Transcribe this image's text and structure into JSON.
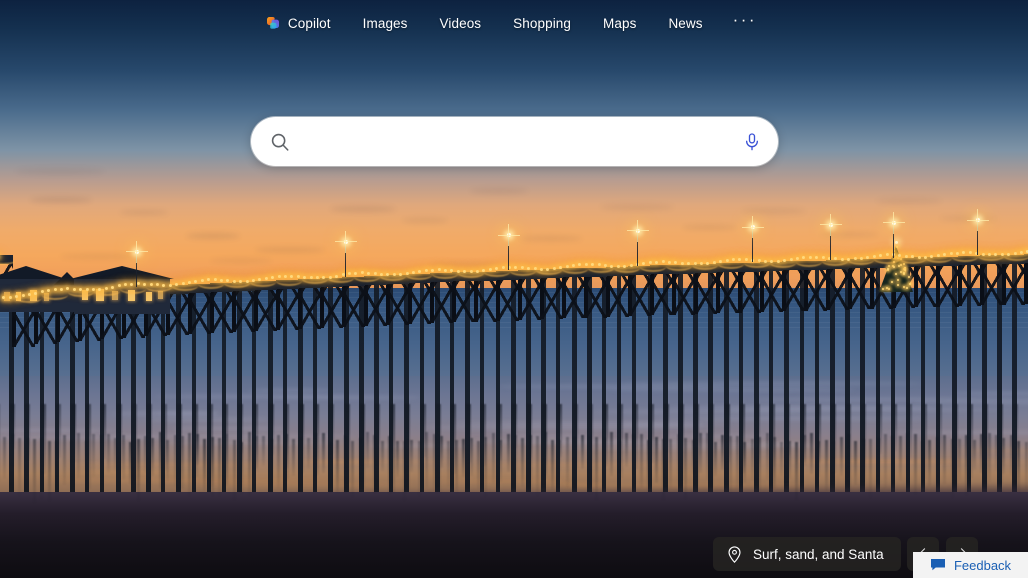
{
  "nav": {
    "copilot": {
      "label": "Copilot",
      "icon": "copilot-logo-icon"
    },
    "items": [
      {
        "label": "Images"
      },
      {
        "label": "Videos"
      },
      {
        "label": "Shopping"
      },
      {
        "label": "Maps"
      },
      {
        "label": "News"
      }
    ],
    "more": {
      "label": "···",
      "icon": "more-horizontal-icon"
    }
  },
  "search": {
    "value": "",
    "placeholder": "",
    "search_icon": "search-icon",
    "mic_icon": "microphone-icon"
  },
  "bottom": {
    "location": {
      "label": "Surf, sand, and Santa",
      "icon": "map-pin-icon"
    },
    "prev": {
      "label": "Previous image",
      "icon": "chevron-left-icon"
    },
    "next": {
      "label": "Next image",
      "icon": "chevron-right-icon"
    },
    "feedback": {
      "label": "Feedback",
      "icon": "speech-bubble-icon"
    }
  },
  "colors": {
    "accent_blue": "#1a5fb4",
    "mic_blue": "#3b52d6",
    "pill_bg": "#262422",
    "sky_top": "#0d2240",
    "sky_sunset": "#f5a85d",
    "ocean": "#3a5b84",
    "bulb": "#ffe08a"
  }
}
